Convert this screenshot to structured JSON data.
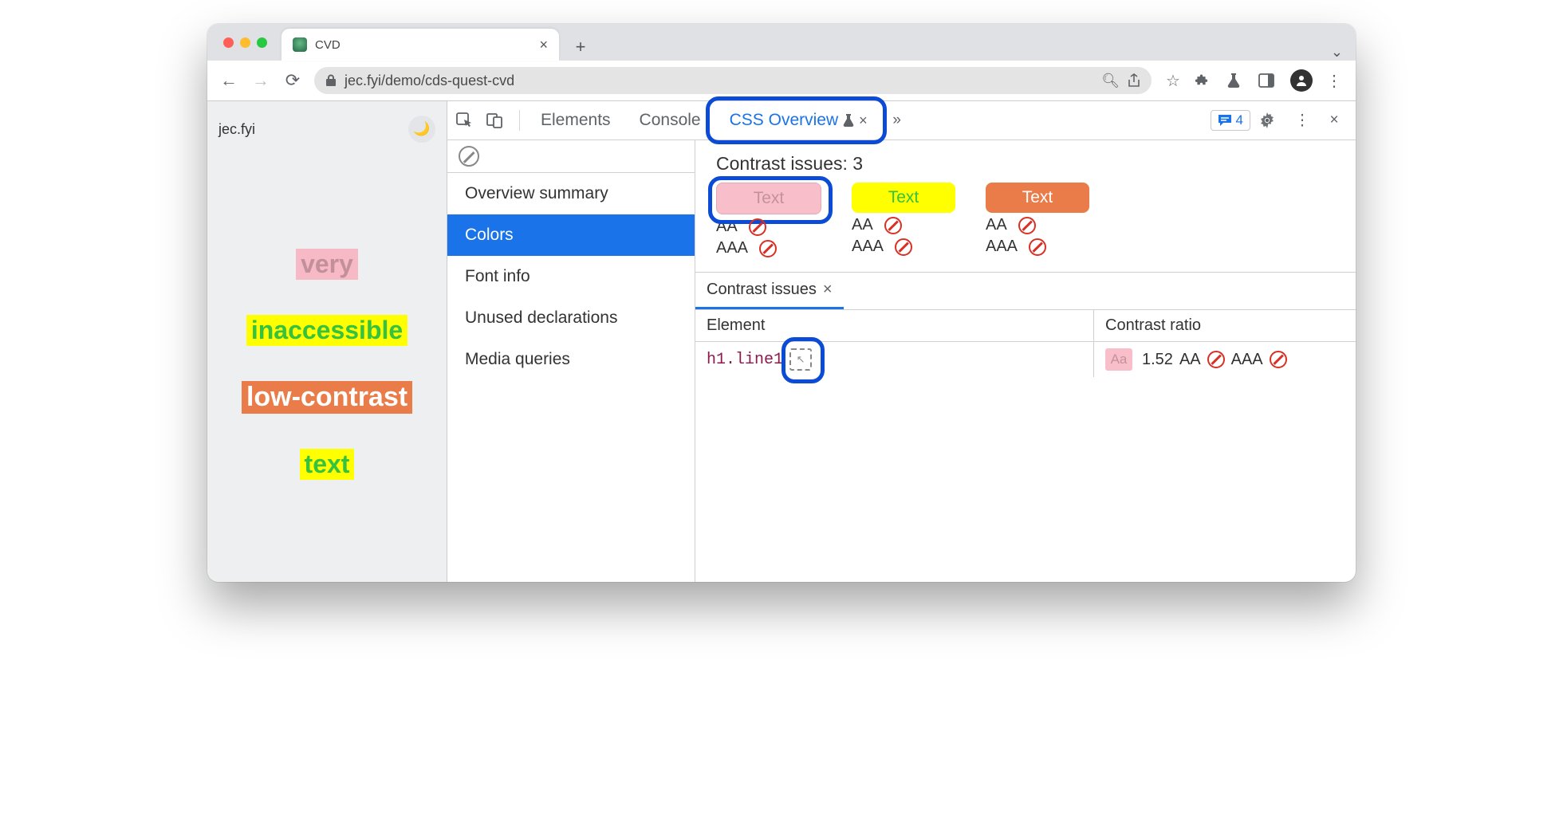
{
  "browser": {
    "tab_title": "CVD",
    "url_display": "jec.fyi/demo/cds-quest-cvd"
  },
  "page": {
    "site_label": "jec.fyi",
    "lines": [
      "very",
      "inaccessible",
      "low-contrast",
      "text"
    ]
  },
  "devtools": {
    "tabs": {
      "elements": "Elements",
      "console": "Console",
      "css_overview": "CSS Overview"
    },
    "message_count": "4",
    "sidebar": {
      "overview_summary": "Overview summary",
      "colors": "Colors",
      "font_info": "Font info",
      "unused_declarations": "Unused declarations",
      "media_queries": "Media queries"
    },
    "contrast": {
      "title": "Contrast issues: 3",
      "swatch_label": "Text",
      "aa": "AA",
      "aaa": "AAA",
      "panel_tab": "Contrast issues",
      "col_element": "Element",
      "col_ratio": "Contrast ratio",
      "row": {
        "element": "h1.line1",
        "chip": "Aa",
        "ratio": "1.52",
        "aa": "AA",
        "aaa": "AAA"
      }
    }
  }
}
